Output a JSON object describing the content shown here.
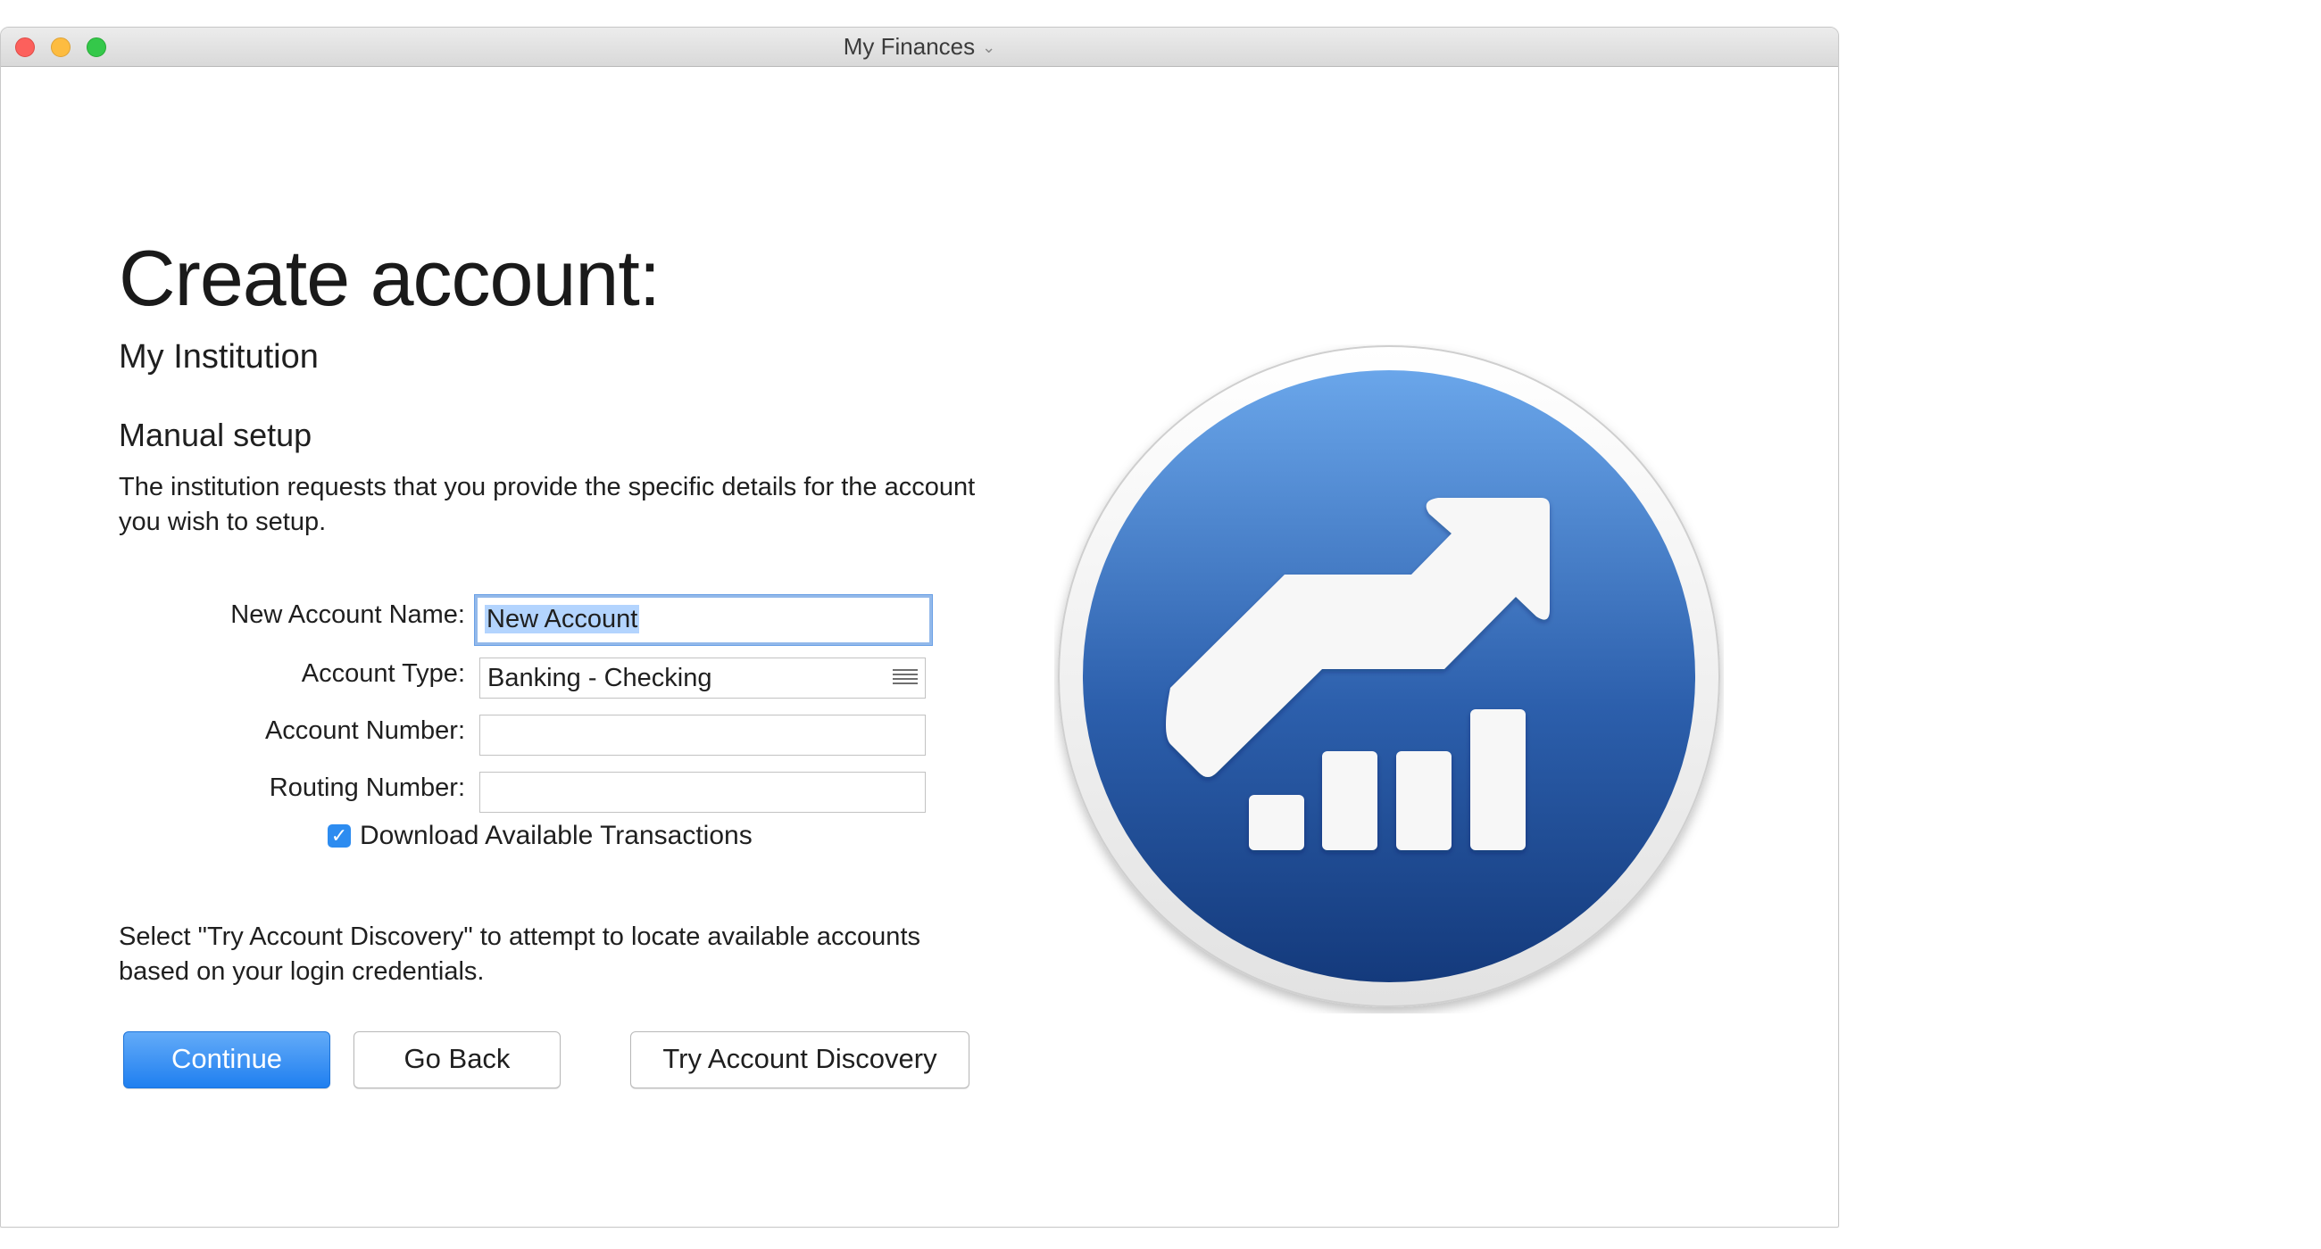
{
  "window": {
    "title": "My Finances",
    "title_chevron": "⌄"
  },
  "page": {
    "heading": "Create account:",
    "institution": "My Institution",
    "subheading": "Manual setup",
    "description": "The institution requests that you provide the specific details for the account you wish to setup.",
    "hint": "Select \"Try Account Discovery\" to attempt to locate available accounts based on your login credentials."
  },
  "form": {
    "account_name": {
      "label": "New Account Name:",
      "value": "New Account"
    },
    "account_type": {
      "label": "Account Type:",
      "value": "Banking - Checking"
    },
    "account_number": {
      "label": "Account Number:",
      "value": ""
    },
    "routing_number": {
      "label": "Routing Number:",
      "value": ""
    },
    "download_checkbox": {
      "label": "Download Available Transactions",
      "checked": true,
      "mark": "✓"
    }
  },
  "buttons": {
    "continue": "Continue",
    "go_back": "Go Back",
    "try_discovery": "Try Account Discovery"
  },
  "icons": {
    "app_icon": "finance-growth-icon",
    "select_icon": "list-lines-icon"
  },
  "colors": {
    "accent": "#1f7ff0",
    "icon_blue_top": "#6aa6ea",
    "icon_blue_bottom": "#143a7c",
    "focus_ring": "#93b9ea"
  }
}
